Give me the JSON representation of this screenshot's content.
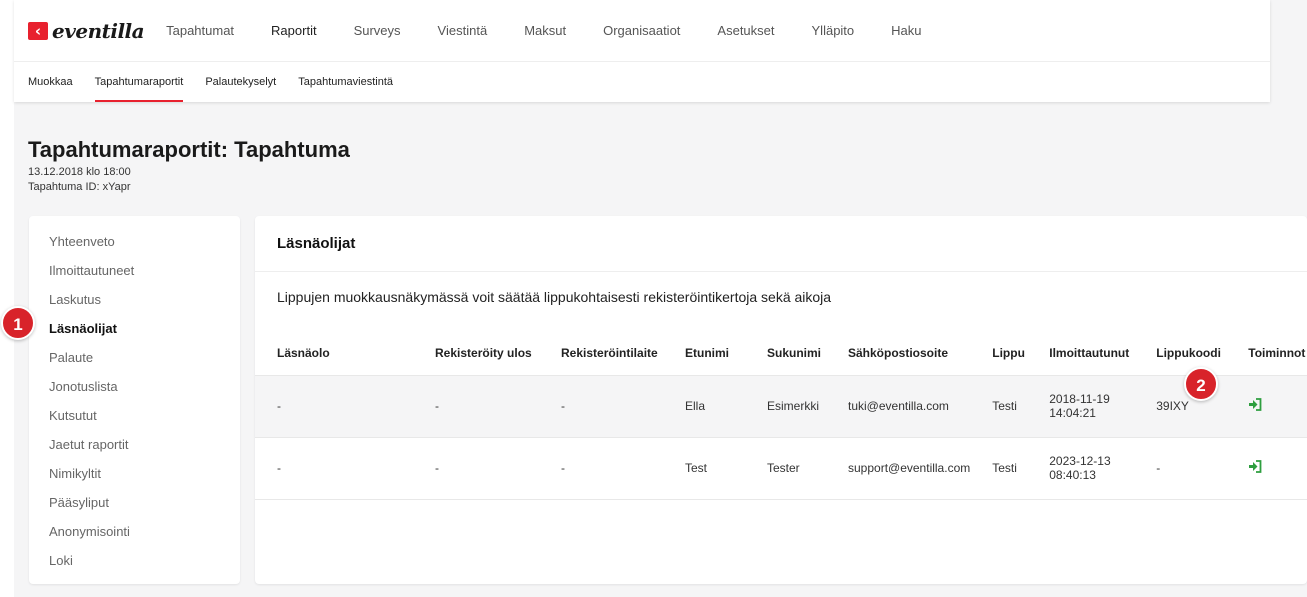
{
  "brand": {
    "logo_text": "eventilla",
    "accent_color": "#e8212e"
  },
  "nav": {
    "items": [
      {
        "label": "Tapahtumat",
        "active": false
      },
      {
        "label": "Raportit",
        "active": true
      },
      {
        "label": "Surveys",
        "active": false
      },
      {
        "label": "Viestintä",
        "active": false
      },
      {
        "label": "Maksut",
        "active": false
      },
      {
        "label": "Organisaatiot",
        "active": false
      },
      {
        "label": "Asetukset",
        "active": false
      },
      {
        "label": "Ylläpito",
        "active": false
      },
      {
        "label": "Haku",
        "active": false
      }
    ]
  },
  "subnav": {
    "items": [
      {
        "label": "Muokkaa",
        "active": false
      },
      {
        "label": "Tapahtumaraportit",
        "active": true
      },
      {
        "label": "Palautekyselyt",
        "active": false
      },
      {
        "label": "Tapahtumaviestintä",
        "active": false
      }
    ]
  },
  "page": {
    "title": "Tapahtumaraportit: Tapahtuma",
    "date": "13.12.2018 klo 18:00",
    "event_id": "Tapahtuma ID: xYapr"
  },
  "sidebar": {
    "items": [
      {
        "label": "Yhteenveto",
        "active": false
      },
      {
        "label": "Ilmoittautuneet",
        "active": false
      },
      {
        "label": "Laskutus",
        "active": false
      },
      {
        "label": "Läsnäolijat",
        "active": true
      },
      {
        "label": "Palaute",
        "active": false
      },
      {
        "label": "Jonotuslista",
        "active": false
      },
      {
        "label": "Kutsutut",
        "active": false
      },
      {
        "label": "Jaetut raportit",
        "active": false
      },
      {
        "label": "Nimikyltit",
        "active": false
      },
      {
        "label": "Pääsyliput",
        "active": false
      },
      {
        "label": "Anonymisointi",
        "active": false
      },
      {
        "label": "Loki",
        "active": false
      }
    ]
  },
  "main": {
    "heading": "Läsnäolijat",
    "description": "Lippujen muokkausnäkymässä voit säätää lippukohtaisesti rekisteröintikertoja sekä aikoja",
    "table": {
      "headers": [
        "Läsnäolo",
        "Rekisteröity ulos",
        "Rekisteröintilaite",
        "Etunimi",
        "Sukunimi",
        "Sähköpostiosoite",
        "Lippu",
        "Ilmoittautunut",
        "Lippukoodi",
        "Toiminnot"
      ],
      "rows": [
        {
          "presence": "-",
          "checked_out": "-",
          "device": "-",
          "first_name": "Ella",
          "last_name": "Esimerkki",
          "email": "tuki@eventilla.com",
          "ticket": "Testi",
          "registered_date": "2018-11-19",
          "registered_time": "14:04:21",
          "ticket_code": "39IXY",
          "action_icon": "sign-in-icon"
        },
        {
          "presence": "-",
          "checked_out": "-",
          "device": "-",
          "first_name": "Test",
          "last_name": "Tester",
          "email": "support@eventilla.com",
          "ticket": "Testi",
          "registered_date": "2023-12-13",
          "registered_time": "08:40:13",
          "ticket_code": "-",
          "action_icon": "sign-in-icon"
        }
      ]
    }
  },
  "markers": {
    "one": "1",
    "two": "2",
    "color": "#d8232a"
  },
  "icon_color": "#2e9e3f"
}
